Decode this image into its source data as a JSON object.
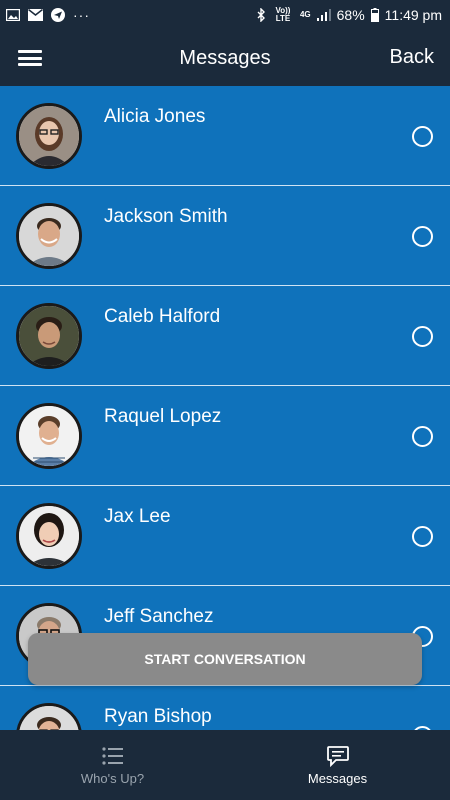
{
  "status_bar": {
    "icons_left": [
      "image-icon",
      "email-icon",
      "send-icon"
    ],
    "overflow": "···",
    "volte": "Vo)) LTE",
    "network": "4G",
    "battery": "68%",
    "time": "11:49 pm"
  },
  "header": {
    "title": "Messages",
    "back_label": "Back",
    "menu_icon": "hamburger-icon"
  },
  "contacts": [
    {
      "name": "Alicia Jones"
    },
    {
      "name": "Jackson Smith"
    },
    {
      "name": "Caleb Halford"
    },
    {
      "name": "Raquel Lopez"
    },
    {
      "name": "Jax Lee"
    },
    {
      "name": "Jeff Sanchez"
    },
    {
      "name": "Ryan Bishop"
    }
  ],
  "toast": {
    "label": "START CONVERSATION"
  },
  "bottom_nav": {
    "items": [
      {
        "label": "Who's Up?",
        "icon": "list-icon",
        "active": false
      },
      {
        "label": "Messages",
        "icon": "chat-icon",
        "active": true
      }
    ]
  },
  "colors": {
    "header_bg": "#1b2a3b",
    "list_bg": "#0f72bb",
    "toast_bg": "#8a8a8a"
  }
}
